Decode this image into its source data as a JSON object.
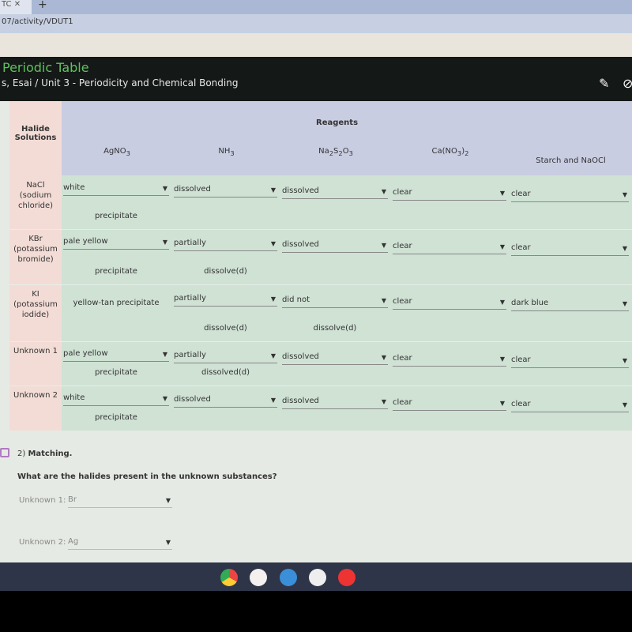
{
  "browser": {
    "tab": "TC",
    "url": "07/activity/VDUT1"
  },
  "header": {
    "title": "Periodic Table",
    "breadcrumb": "s, Esai / Unit 3 - Periodicity and Chemical Bonding"
  },
  "table": {
    "corner": "Halide Solutions",
    "reagents_label": "Reagents",
    "columns": [
      "AgNO3",
      "NH3",
      "Na2S2O3",
      "Ca(NO3)2",
      "Starch and NaOCl"
    ],
    "rows": [
      {
        "label": "NaCl (sodium chloride)",
        "cells": [
          {
            "sel": "white",
            "text": "precipitate"
          },
          {
            "sel": "dissolved",
            "text": ""
          },
          {
            "sel": "dissolved",
            "text": ""
          },
          {
            "sel": "clear",
            "text": ""
          },
          {
            "sel": "clear",
            "text": ""
          }
        ]
      },
      {
        "label": "KBr (potassium bromide)",
        "cells": [
          {
            "sel": "pale yellow",
            "text": "precipitate"
          },
          {
            "sel": "partially",
            "text": "dissolve(d)"
          },
          {
            "sel": "dissolved",
            "text": ""
          },
          {
            "sel": "clear",
            "text": ""
          },
          {
            "sel": "clear",
            "text": ""
          }
        ]
      },
      {
        "label": "KI (potassium iodide)",
        "cells": [
          {
            "sel": "",
            "text": "yellow-tan precipitate"
          },
          {
            "sel": "partially",
            "text": "dissolve(d)"
          },
          {
            "sel": "did not",
            "text": "dissolve(d)"
          },
          {
            "sel": "clear",
            "text": ""
          },
          {
            "sel": "dark blue",
            "text": ""
          }
        ]
      },
      {
        "label": "Unknown 1",
        "cells": [
          {
            "sel": "pale yellow",
            "text": "precipitate"
          },
          {
            "sel": "partially",
            "text": "dissolved(d)"
          },
          {
            "sel": "dissolved",
            "text": ""
          },
          {
            "sel": "clear",
            "text": ""
          },
          {
            "sel": "clear",
            "text": ""
          }
        ]
      },
      {
        "label": "Unknown 2",
        "cells": [
          {
            "sel": "white",
            "text": "precipitate"
          },
          {
            "sel": "dissolved",
            "text": ""
          },
          {
            "sel": "dissolved",
            "text": ""
          },
          {
            "sel": "clear",
            "text": ""
          },
          {
            "sel": "clear",
            "text": ""
          }
        ]
      }
    ]
  },
  "question": {
    "number": "2)",
    "title": "Matching.",
    "prompt": "What are the halides present in the unknown substances?",
    "answers": [
      {
        "label": "Unknown 1:",
        "value": "Br"
      },
      {
        "label": "Unknown 2:",
        "value": "Ag"
      }
    ]
  },
  "taskbar": {
    "apps": [
      "chrome-icon",
      "gmail-icon",
      "files-icon",
      "play-store-icon",
      "youtube-icon"
    ]
  }
}
